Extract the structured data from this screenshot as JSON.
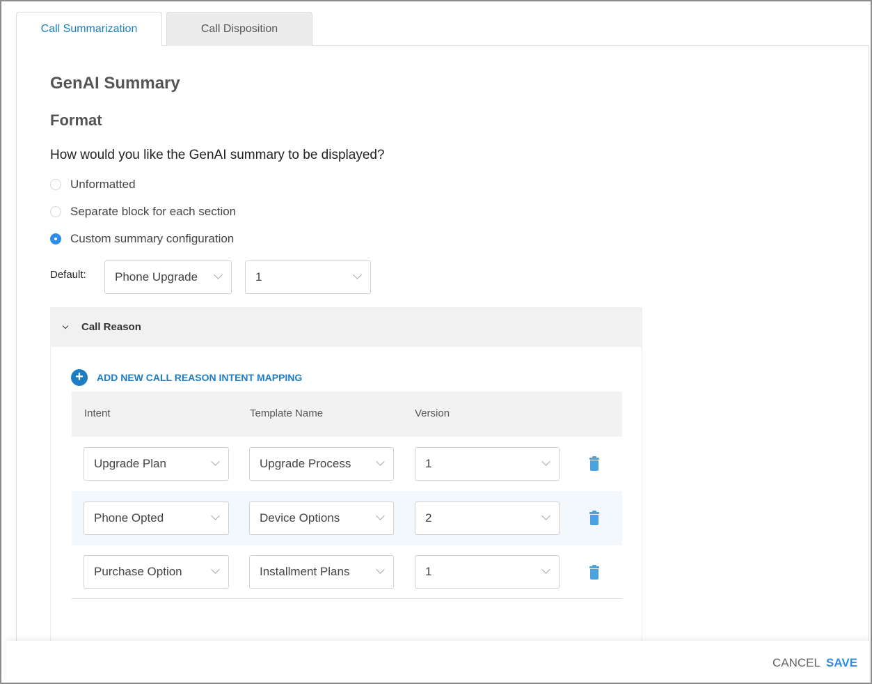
{
  "tabs": [
    {
      "label": "Call Summarization",
      "active": true
    },
    {
      "label": "Call Disposition",
      "active": false
    }
  ],
  "heading": "GenAI Summary",
  "subheading": "Format",
  "question": "How would you like the GenAI summary to be displayed?",
  "format_options": [
    {
      "label": "Unformatted",
      "selected": false
    },
    {
      "label": "Separate block for each section",
      "selected": false
    },
    {
      "label": "Custom summary configuration",
      "selected": true
    }
  ],
  "default": {
    "label": "Default:",
    "template": "Phone Upgrade",
    "version": "1"
  },
  "section": {
    "title": "Call Reason",
    "expanded": true,
    "add_label": "ADD NEW CALL REASON INTENT MAPPING",
    "columns": [
      "Intent",
      "Template Name",
      "Version"
    ],
    "rows": [
      {
        "intent": "Upgrade Plan",
        "template": "Upgrade Process",
        "version": "1"
      },
      {
        "intent": "Phone Opted",
        "template": "Device Options",
        "version": "2"
      },
      {
        "intent": "Purchase Option",
        "template": "Installment Plans",
        "version": "1"
      }
    ]
  },
  "footer": {
    "cancel_label": "CANCEL",
    "save_label": "SAVE"
  },
  "colors": {
    "accent": "#2f8ce8",
    "link": "#1c7dc4",
    "trash": "#4aa3df",
    "header_bg": "#f1f1f1",
    "alt_row_bg": "#f3f8fd"
  }
}
